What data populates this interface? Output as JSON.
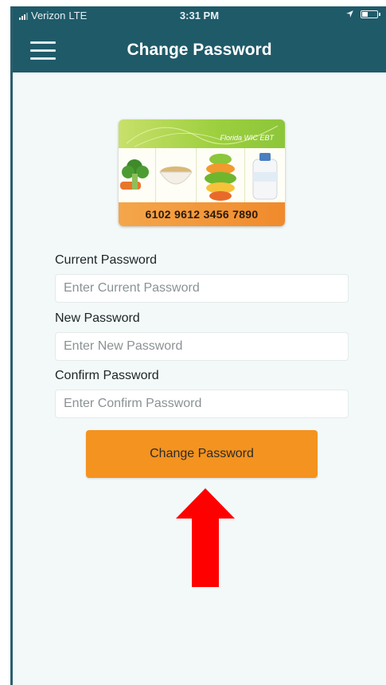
{
  "status_bar": {
    "carrier": "Verizon",
    "network": "LTE",
    "time": "3:31 PM"
  },
  "header": {
    "title": "Change Password",
    "menu_icon": "hamburger-menu-icon"
  },
  "card": {
    "brand": "Florida WIC EBT",
    "number": "6102 9612 3456 7890"
  },
  "form": {
    "current": {
      "label": "Current Password",
      "placeholder": "Enter Current Password"
    },
    "new": {
      "label": "New Password",
      "placeholder": "Enter New Password"
    },
    "confirm": {
      "label": "Confirm Password",
      "placeholder": "Enter Confirm Password"
    },
    "submit_label": "Change Password"
  },
  "colors": {
    "header_bg": "#1f5a69",
    "button_bg": "#f4931f",
    "arrow": "#ff0000"
  }
}
